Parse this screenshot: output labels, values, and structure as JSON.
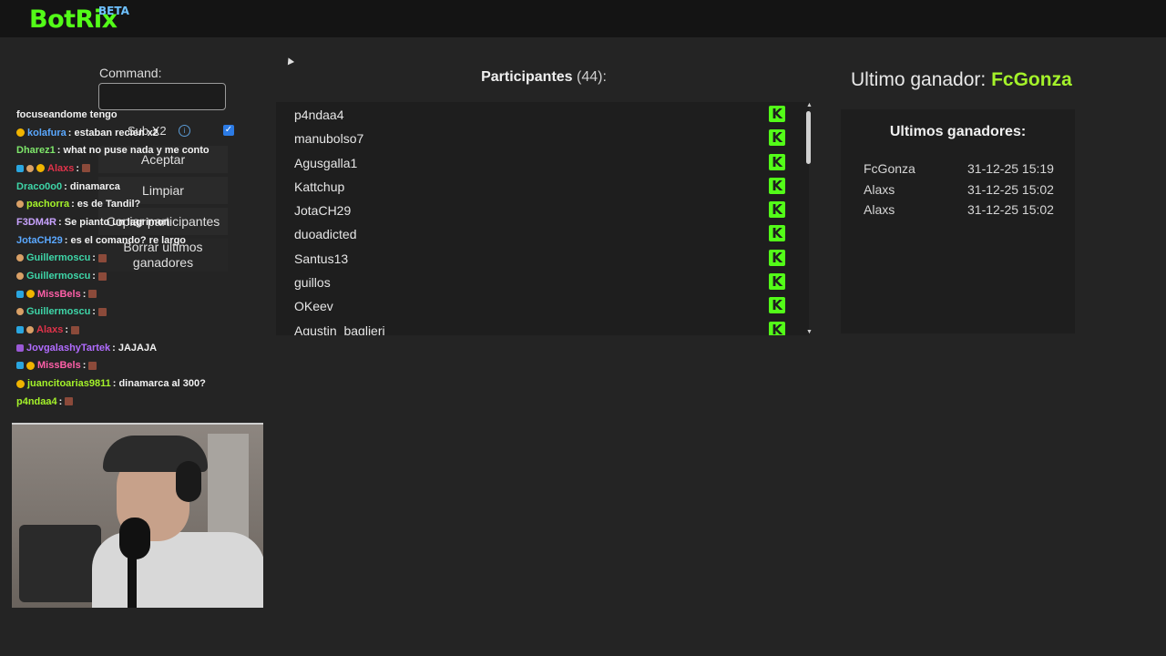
{
  "app": {
    "logo": "BotRix",
    "badge": "BETA"
  },
  "command_panel": {
    "label": "Command:",
    "input_value": "",
    "sub_option": "Sub X2",
    "sub_checked": true,
    "buttons": {
      "accept": "Aceptar",
      "clear": "Limpiar",
      "copy": "Copiar participantes",
      "clear_winners": "Borrar ultimos ganadores"
    }
  },
  "chat": [
    {
      "user": "",
      "text": "focuseandome tengo",
      "color": "#f2f2f2",
      "badges": []
    },
    {
      "user": "kolafura",
      "text": ": estaban recien x2",
      "color": "#5aa8ff",
      "badges": [
        "gold"
      ]
    },
    {
      "user": "Dharez1",
      "text": ": what no puse nada y me conto",
      "color": "#7ee66a",
      "badges": []
    },
    {
      "user": "Alaxs",
      "text": ":",
      "color": "#e0334a",
      "badges": [
        "blue",
        "skin",
        "gold"
      ],
      "emote": true
    },
    {
      "user": "Draco0o0",
      "text": ": dinamarca",
      "color": "#3ed6a8",
      "badges": []
    },
    {
      "user": "pachorra",
      "text": ": es de Tandil?",
      "color": "#a4f22a",
      "badges": [
        "skin"
      ]
    },
    {
      "user": "F3DM4R",
      "text": ": Se pianto un lagrimon",
      "color": "#c9a3ff",
      "badges": []
    },
    {
      "user": "JotaCH29",
      "text": ": es el comando? re largo",
      "color": "#5aa8ff",
      "badges": []
    },
    {
      "user": "Guillermoscu",
      "text": ":",
      "color": "#3ed6a8",
      "badges": [
        "skin"
      ],
      "emote": true
    },
    {
      "user": "Guillermoscu",
      "text": ":",
      "color": "#3ed6a8",
      "badges": [
        "skin"
      ],
      "emote": true
    },
    {
      "user": "MissBels",
      "text": ":",
      "color": "#ff5fa8",
      "badges": [
        "blue",
        "gold"
      ],
      "emote": true
    },
    {
      "user": "Guillermoscu",
      "text": ":",
      "color": "#3ed6a8",
      "badges": [
        "skin"
      ],
      "emote": true
    },
    {
      "user": "Alaxs",
      "text": ":",
      "color": "#e0334a",
      "badges": [
        "blue",
        "skin"
      ],
      "emote": true
    },
    {
      "user": "JovgalashyTartek",
      "text": ": JAJAJA",
      "color": "#b16cff",
      "badges": [
        "purple"
      ]
    },
    {
      "user": "MissBels",
      "text": ":",
      "color": "#ff5fa8",
      "badges": [
        "blue",
        "gold"
      ],
      "emote": true
    },
    {
      "user": "juancitoarias9811",
      "text": ": dinamarca al 300?",
      "color": "#a4f22a",
      "badges": [
        "gold"
      ]
    },
    {
      "user": "p4ndaa4",
      "text": ":",
      "color": "#a4f22a",
      "badges": [],
      "emote": true
    }
  ],
  "participants": {
    "title": "Participantes",
    "count": "(44):",
    "items": [
      "p4ndaa4",
      "manubolso7",
      "Agusgalla1",
      "Kattchup",
      "JotaCH29",
      "duoadicted",
      "Santus13",
      "guillos",
      "OKeev",
      "Agustin_baglieri"
    ]
  },
  "last_winner": {
    "label": "Ultimo ganador:",
    "name": "FcGonza"
  },
  "winners": {
    "title": "Ultimos ganadores:",
    "rows": [
      {
        "name": "FcGonza",
        "date": "31-12-25 15:19"
      },
      {
        "name": "Alaxs",
        "date": "31-12-25 15:02"
      },
      {
        "name": "Alaxs",
        "date": "31-12-25 15:02"
      }
    ]
  },
  "icons": {
    "platform": "kick-icon",
    "info": "info-icon"
  },
  "colors": {
    "brand": "#53fc18",
    "winner": "#a4f22a"
  }
}
